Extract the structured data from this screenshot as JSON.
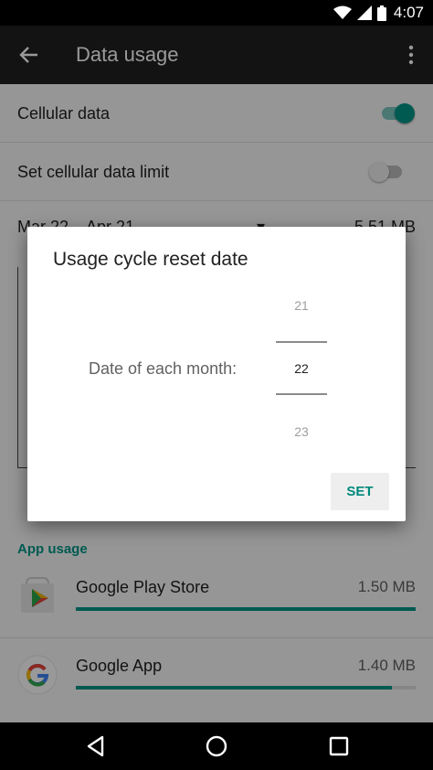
{
  "status_bar": {
    "time": "4:07"
  },
  "toolbar": {
    "title": "Data usage"
  },
  "settings": {
    "cellular_data": {
      "label": "Cellular data",
      "enabled": true
    },
    "data_limit": {
      "label": "Set cellular data limit",
      "enabled": false
    },
    "cycle": {
      "range": "Mar 22 – Apr 21",
      "separator": "▾",
      "total": "5.51 MB"
    }
  },
  "app_usage": {
    "header": "App usage",
    "apps": [
      {
        "name": "Google Play Store",
        "size": "1.50 MB",
        "fraction": 1.0,
        "icon": "play-store-icon"
      },
      {
        "name": "Google App",
        "size": "1.40 MB",
        "fraction": 0.93,
        "icon": "google-g-icon"
      }
    ]
  },
  "dialog": {
    "title": "Usage cycle reset date",
    "picker_label": "Date of each month:",
    "picker": {
      "previous": "21",
      "selected": "22",
      "next": "23"
    },
    "set_button": "SET"
  },
  "colors": {
    "accent": "#009688",
    "toolbar": "#212121"
  }
}
